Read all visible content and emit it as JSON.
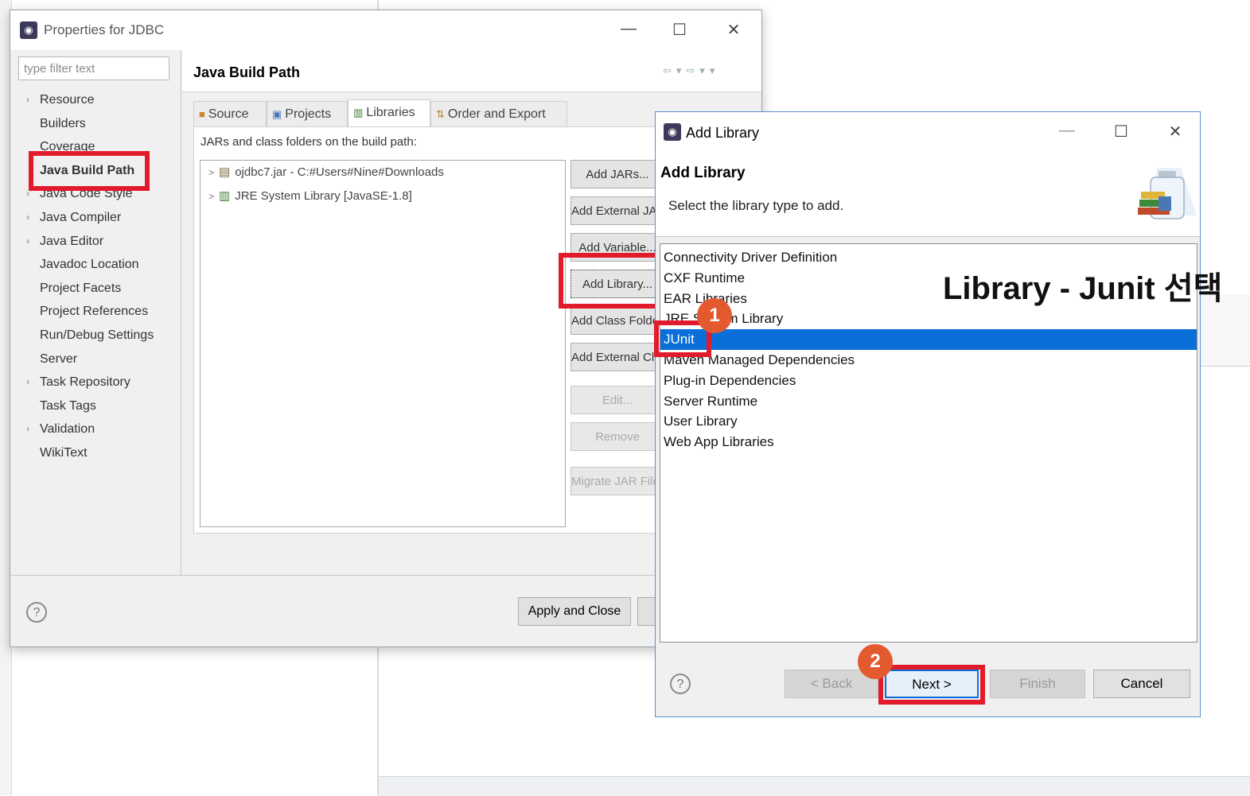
{
  "properties_window": {
    "title": "Properties for JDBC",
    "filter_placeholder": "type filter text",
    "tree": [
      {
        "label": "Resource",
        "expandable": true
      },
      {
        "label": "Builders",
        "expandable": false
      },
      {
        "label": "Coverage",
        "expandable": false
      },
      {
        "label": "Java Build Path",
        "expandable": false,
        "selected": true
      },
      {
        "label": "Java Code Style",
        "expandable": true
      },
      {
        "label": "Java Compiler",
        "expandable": true
      },
      {
        "label": "Java Editor",
        "expandable": true
      },
      {
        "label": "Javadoc Location",
        "expandable": false
      },
      {
        "label": "Project Facets",
        "expandable": false
      },
      {
        "label": "Project References",
        "expandable": false
      },
      {
        "label": "Run/Debug Settings",
        "expandable": false
      },
      {
        "label": "Server",
        "expandable": false
      },
      {
        "label": "Task Repository",
        "expandable": true
      },
      {
        "label": "Task Tags",
        "expandable": false
      },
      {
        "label": "Validation",
        "expandable": true
      },
      {
        "label": "WikiText",
        "expandable": false
      }
    ],
    "content_title": "Java Build Path",
    "tabs": [
      {
        "label": "Source",
        "icon": "source-folder-icon"
      },
      {
        "label": "Projects",
        "icon": "projects-icon"
      },
      {
        "label": "Libraries",
        "icon": "libraries-icon",
        "active": true
      },
      {
        "label": "Order and Export",
        "icon": "order-export-icon"
      }
    ],
    "jars_label": "JARs and class folders on the build path:",
    "libraries": [
      {
        "label": "ojdbc7.jar - C:#Users#Nine#Downloads",
        "icon": "jar-icon"
      },
      {
        "label": "JRE System Library [JavaSE-1.8]",
        "icon": "library-icon"
      }
    ],
    "side_buttons": [
      {
        "label": "Add JARs...",
        "enabled": true
      },
      {
        "label": "Add External JARs...",
        "enabled": true
      },
      {
        "label": "Add Variable...",
        "enabled": true
      },
      {
        "label": "Add Library...",
        "enabled": true
      },
      {
        "label": "Add Class Folder...",
        "enabled": true
      },
      {
        "label": "Add External Class Folder...",
        "enabled": true
      },
      {
        "label": "Edit...",
        "enabled": false
      },
      {
        "label": "Remove",
        "enabled": false
      },
      {
        "label": "Migrate JAR File...",
        "enabled": false
      }
    ],
    "apply_close_label": "Apply and Close",
    "help_glyph": "?"
  },
  "add_library_dialog": {
    "title": "Add Library",
    "heading": "Add Library",
    "description": "Select the library type to add.",
    "library_types": [
      {
        "label": "Connectivity Driver Definition"
      },
      {
        "label": "CXF Runtime"
      },
      {
        "label": "EAR Libraries"
      },
      {
        "label": "JRE System Library"
      },
      {
        "label": "JUnit",
        "selected": true
      },
      {
        "label": "Maven Managed Dependencies"
      },
      {
        "label": "Plug-in Dependencies"
      },
      {
        "label": "Server Runtime"
      },
      {
        "label": "User Library"
      },
      {
        "label": "Web App Libraries"
      }
    ],
    "buttons": {
      "back": "< Back",
      "next": "Next >",
      "finish": "Finish",
      "cancel": "Cancel"
    },
    "help_glyph": "?"
  },
  "window_controls": {
    "minimize": "—",
    "maximize": "☐",
    "close": "✕"
  },
  "annotations": {
    "caption": "Library - Junit 선택",
    "badge_1": "1",
    "badge_2": "2",
    "highlight_color": "#e21b2c",
    "badge_color": "#e45a2f"
  },
  "colors": {
    "selection": "#0a6fd8",
    "dialog_border": "#5b8fd0"
  }
}
